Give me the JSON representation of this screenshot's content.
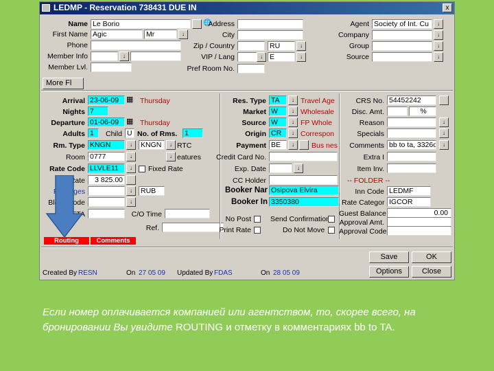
{
  "window": {
    "title": "LEDMP - Reservation 738431 DUE IN",
    "close_glyph": "x"
  },
  "guest": {
    "name_label": "Name",
    "name_value": "Le Borio",
    "first_name_label": "First Name",
    "first_name_value": "Agic",
    "title_value": "Mr",
    "phone_label": "Phone",
    "member_info_label": "Member Info",
    "member_lvl_label": "Member Lvl."
  },
  "address": {
    "address_label": "Address",
    "city_label": "City",
    "zip_country_label": "Zip / Country",
    "country_value": "RU",
    "vip_lang_label": "VIP / Lang",
    "lang_value": "E",
    "pref_room_label": "Pref Room No."
  },
  "company": {
    "agent_label": "Agent",
    "agent_value": "Society of Int. Cu",
    "company_label": "Company",
    "group_label": "Group",
    "source_label": "Source"
  },
  "more_fields_button": "More Fl",
  "stay": {
    "arrival_label": "Arrival",
    "arrival_value": "23-06-09",
    "arrival_day": "Thursday",
    "nights_label": "Nights",
    "nights_value": "7",
    "departure_label": "Departure",
    "departure_value": "01-06-09",
    "departure_day": "Thursday",
    "adults_label": "Adults",
    "adults_value": "1",
    "child_label": "Child",
    "child_value": "U",
    "no_rms_label": "No. of Rms.",
    "no_rms_value": "1",
    "rm_type_label": "Rm. Type",
    "rm_type_value": "KNGN",
    "rtc_value": "KNGN",
    "rtc_label": "RTC",
    "room_label": "Room",
    "room_value": "0777",
    "features_label": "eatures",
    "rate_code_label": "Rate Code",
    "rate_code_value": "LLVLE11",
    "fixed_rate_label": "Fixed Rate",
    "rate_label": "Rate",
    "rate_value": "3 825.00",
    "packages_label": "Packages",
    "currency_value": "RUB",
    "block_code_label": "Block Code",
    "eta_label": "ETA",
    "co_time_label": "C/O Time",
    "ref_label": "Ref."
  },
  "reservation": {
    "res_type_label": "Res. Type",
    "res_type_value": "TA",
    "res_type_desc": "Travel Age",
    "market_label": "Market",
    "market_value": "W",
    "market_desc": "Wholesale",
    "source_label": "Source",
    "source_value": "W",
    "source_desc": "FP Whole",
    "origin_label": "Origin",
    "origin_value": "CR",
    "origin_desc": "Correspon",
    "payment_label": "Payment",
    "payment_value": "BE",
    "payment_desc": "Bus nes",
    "credit_card_label": "Credit Card No.",
    "exp_date_label": "Exp. Date",
    "cc_holder_label": "CC Holder",
    "booker_name_label": "Booker Nar",
    "booker_name_value": "Osipova Elvira",
    "booker_info_label": "Booker In",
    "booker_info_value": "3350380",
    "no_post_label": "No Post",
    "send_confirmation_label": "Send Confirmation",
    "print_rate_label": "Print Rate",
    "do_not_move_label": "Do Not Move"
  },
  "right_panel": {
    "crs_label": "CRS No.",
    "crs_value": "54452242",
    "disc_label": "Disc. Amt.",
    "disc_pct": "%",
    "reason_label": "Reason",
    "specials_label": "Specials",
    "comments_label": "Comments",
    "comments_value": "bb to ta, 3326o",
    "extra_label": "Extra I",
    "item_inv_label": "Item Inv.",
    "folder_header": "-- FOLDER --",
    "inn_code_label": "Inn Code",
    "inn_code_value": "LEDMF",
    "rate_category_label": "Rate Categor",
    "rate_category_value": "IGCOR",
    "guest_balance_label": "Guest Balance",
    "guest_balance_value": "0.00",
    "approval_amt_label": "Approval Amt.",
    "approval_code_label": "Approval Code"
  },
  "tabs": {
    "routing": "Routing",
    "comments": "Comments"
  },
  "buttons": {
    "save": "Save",
    "ok": "OK",
    "options": "Options",
    "close": "Close"
  },
  "footer": {
    "created_by_label": "Created By",
    "created_by_value": "RESN",
    "created_on_label": "On",
    "created_on_value": "27 05 09",
    "updated_by_label": "Updated By",
    "updated_by_value": "FDAS",
    "updated_on_label": "On",
    "updated_on_value": "28 05 09"
  },
  "caption": {
    "part1": "Если номер оплачивается компанией или агентством, то, скорее всего, на бронировании Вы увидите ",
    "part2": "ROUTING и отметку в комментариях bb to TA."
  },
  "colors": {
    "background": "#92cc58",
    "field_highlight": "#00ffff",
    "tab_red": "#ff0000",
    "arrow_blue": "#4a7ec0"
  }
}
